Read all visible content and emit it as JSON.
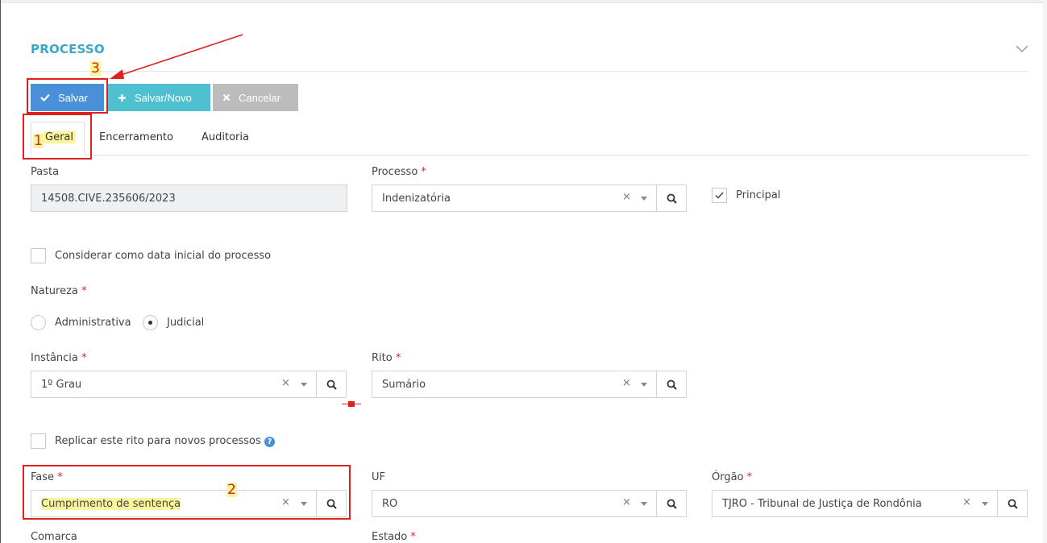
{
  "section": {
    "title": "PROCESSO"
  },
  "toolbar": {
    "save_label": "Salvar",
    "save_new_label": "Salvar/Novo",
    "cancel_label": "Cancelar"
  },
  "tabs": [
    {
      "label": "Geral",
      "active": true
    },
    {
      "label": "Encerramento",
      "active": false
    },
    {
      "label": "Auditoria",
      "active": false
    }
  ],
  "form": {
    "pasta": {
      "label": "Pasta",
      "value": "14508.CIVE.235606/2023"
    },
    "processo": {
      "label": "Processo",
      "required_mark": "*",
      "value": "Indenizatória"
    },
    "principal": {
      "label": "Principal",
      "checked": true
    },
    "considerar": {
      "label": "Considerar como data inicial do processo",
      "checked": false
    },
    "natureza": {
      "label": "Natureza",
      "required_mark": "*",
      "options": [
        {
          "label": "Administrativa",
          "selected": false
        },
        {
          "label": "Judicial",
          "selected": true
        }
      ]
    },
    "instancia": {
      "label": "Instância",
      "required_mark": "*",
      "value": "1º Grau"
    },
    "rito": {
      "label": "Rito",
      "required_mark": "*",
      "value": "Sumário"
    },
    "replicar": {
      "label": "Replicar este rito para novos processos",
      "checked": false,
      "help": "?"
    },
    "fase": {
      "label": "Fase",
      "required_mark": "*",
      "value": "Cumprimento de sentença"
    },
    "uf": {
      "label": "UF",
      "value": "RO"
    },
    "orgao": {
      "label": "Órgão",
      "required_mark": "*",
      "value": "TJRO - Tribunal de Justiça de Rondônia"
    },
    "comarca": {
      "label": "Comarca"
    },
    "estado": {
      "label": "Estado",
      "required_mark": "*"
    }
  },
  "select_controls": {
    "clear": "×"
  },
  "annotations": {
    "n1": "1",
    "n2": "2",
    "n3": "3"
  },
  "colors": {
    "accent": "#3aa8c6",
    "save": "#4a90d9",
    "save_new": "#4ec0cf",
    "cancel": "#bcbcbc",
    "annotation": "#e02020",
    "highlight": "#fbf59a"
  }
}
